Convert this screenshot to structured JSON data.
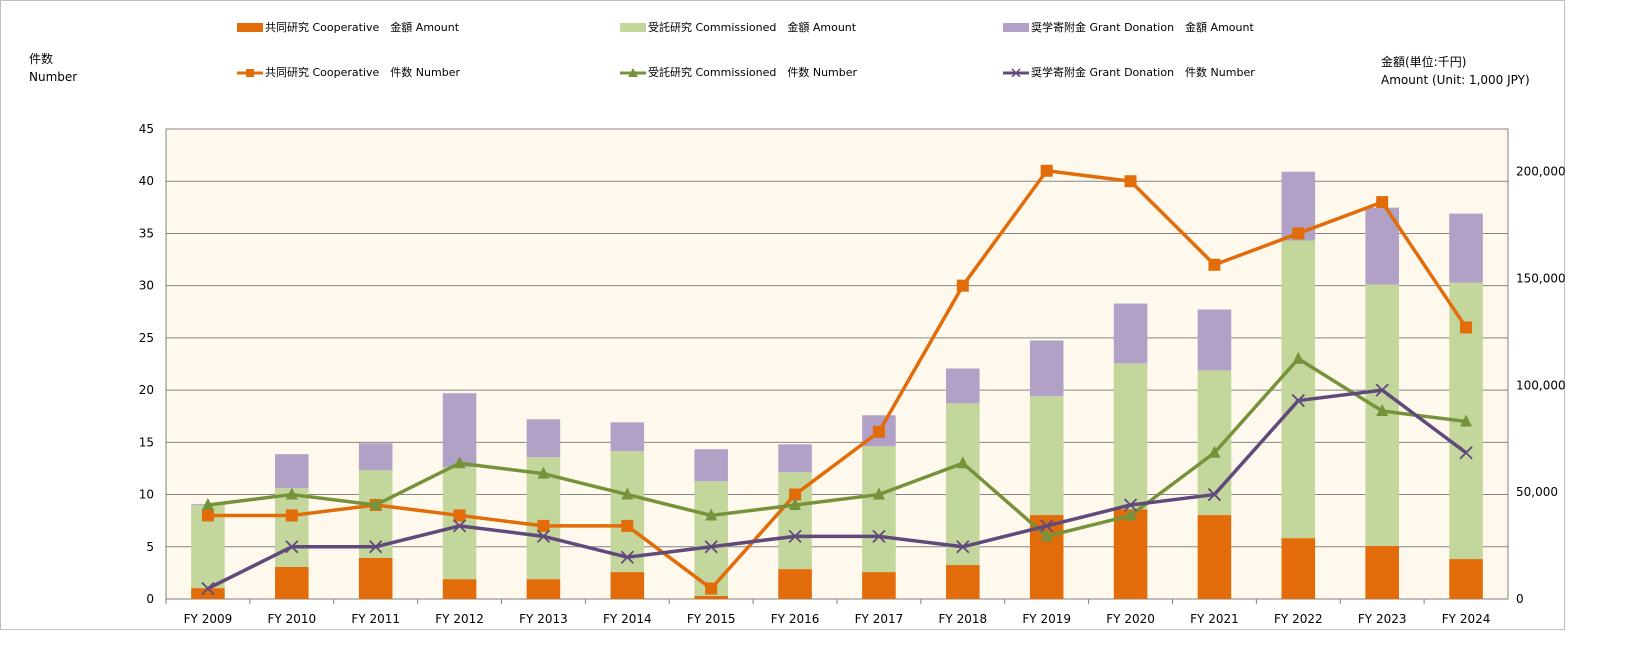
{
  "chart_data": {
    "type": "bar+line",
    "categories": [
      "FY 2009",
      "FY 2010",
      "FY 2011",
      "FY 2012",
      "FY 2013",
      "FY 2014",
      "FY 2015",
      "FY 2016",
      "FY 2017",
      "FY 2018",
      "FY 2019",
      "FY 2020",
      "FY 2021",
      "FY 2022",
      "FY 2023",
      "FY 2024"
    ],
    "left_axis": {
      "label_ja": "件数",
      "label_en": "Number",
      "ylim": [
        0,
        45
      ],
      "ticks": [
        0,
        5,
        10,
        15,
        20,
        25,
        30,
        35,
        40,
        45
      ]
    },
    "right_axis": {
      "label_ja": "金額(単位:千円)",
      "label_en": "Amount (Unit: 1,000 JPY)",
      "ylim": [
        0,
        220000
      ],
      "ticks": [
        0,
        50000,
        100000,
        150000,
        200000
      ],
      "tick_labels": [
        "0",
        "50,000",
        "100,000",
        "150,000",
        "200,000"
      ]
    },
    "grid": true,
    "legend_placement": "top",
    "plot_background": "#fef9ec",
    "bar_series": [
      {
        "name": "共同研究 Cooperative　金額 Amount",
        "color": "#e36c0a",
        "values": [
          5100,
          15000,
          19200,
          9300,
          9300,
          12600,
          1400,
          14000,
          12600,
          15900,
          39300,
          42000,
          39300,
          28500,
          24800,
          18700
        ]
      },
      {
        "name": "受託研究 Commissioned　金額 Amount",
        "color": "#c3d69b",
        "values": [
          38800,
          36900,
          41100,
          52400,
          57100,
          56600,
          53700,
          45300,
          58900,
          75700,
          55600,
          68300,
          67700,
          139300,
          122400,
          129400
        ]
      },
      {
        "name": "奨学寄附金 Grant Donation　金額 Amount",
        "color": "#b2a1c7",
        "values": [
          500,
          15900,
          12600,
          34600,
          17700,
          13500,
          15000,
          13100,
          14500,
          16300,
          26100,
          28000,
          28500,
          32200,
          36000,
          32300
        ]
      }
    ],
    "line_series": [
      {
        "name": "共同研究 Cooperative　件数 Number",
        "color": "#e36c0a",
        "marker": "square",
        "values": [
          8,
          8,
          9,
          8,
          7,
          7,
          1,
          10,
          16,
          30,
          41,
          40,
          32,
          35,
          38,
          26
        ]
      },
      {
        "name": "受託研究 Commissioned　件数 Number",
        "color": "#76933c",
        "marker": "triangle",
        "values": [
          9,
          10,
          9,
          13,
          12,
          10,
          8,
          9,
          10,
          13,
          6,
          8,
          14,
          23,
          18,
          17
        ]
      },
      {
        "name": "奨学寄附金 Grant Donation　件数 Number",
        "color": "#604a7b",
        "marker": "x",
        "values": [
          1,
          5,
          5,
          7,
          6,
          4,
          5,
          6,
          6,
          5,
          7,
          9,
          10,
          19,
          20,
          14
        ]
      }
    ]
  }
}
